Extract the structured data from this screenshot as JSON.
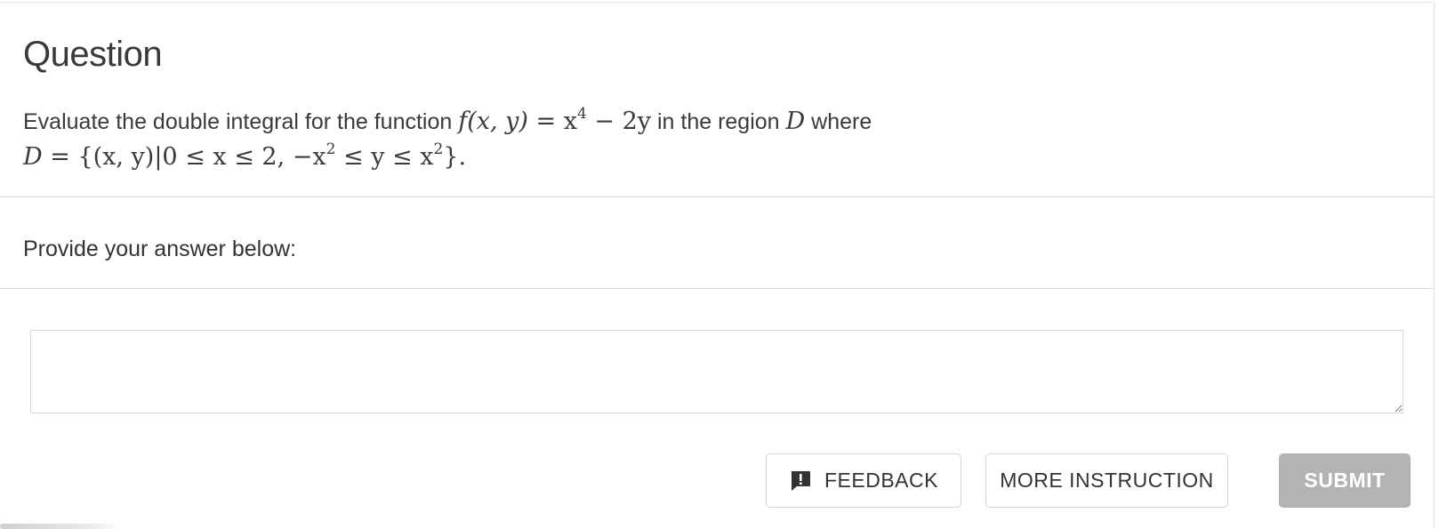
{
  "question": {
    "title": "Question",
    "intro": "Evaluate the double integral for the function ",
    "func_lhs": "f(x, y)",
    "func_eq": " = x",
    "func_exp": "4",
    "func_rest": " − 2y",
    "region_text": " in the region ",
    "region_var": "D",
    "where_text": " where",
    "domain_lhs": "D",
    "domain_eq": " = {(x, y)|0 ≤ x ≤ 2,  −x",
    "domain_exp1": "2",
    "domain_mid": " ≤ y ≤ x",
    "domain_exp2": "2",
    "domain_end": "}."
  },
  "answer": {
    "prompt": "Provide your answer below:",
    "value": "",
    "placeholder": ""
  },
  "actions": {
    "feedback_label": "FEEDBACK",
    "feedback_icon": "feedback-icon",
    "more_instruction_label": "MORE INSTRUCTION",
    "submit_label": "SUBMIT"
  },
  "colors": {
    "submit_bg": "#b3b3b3",
    "border": "#d6d6d6",
    "text": "#333333"
  }
}
